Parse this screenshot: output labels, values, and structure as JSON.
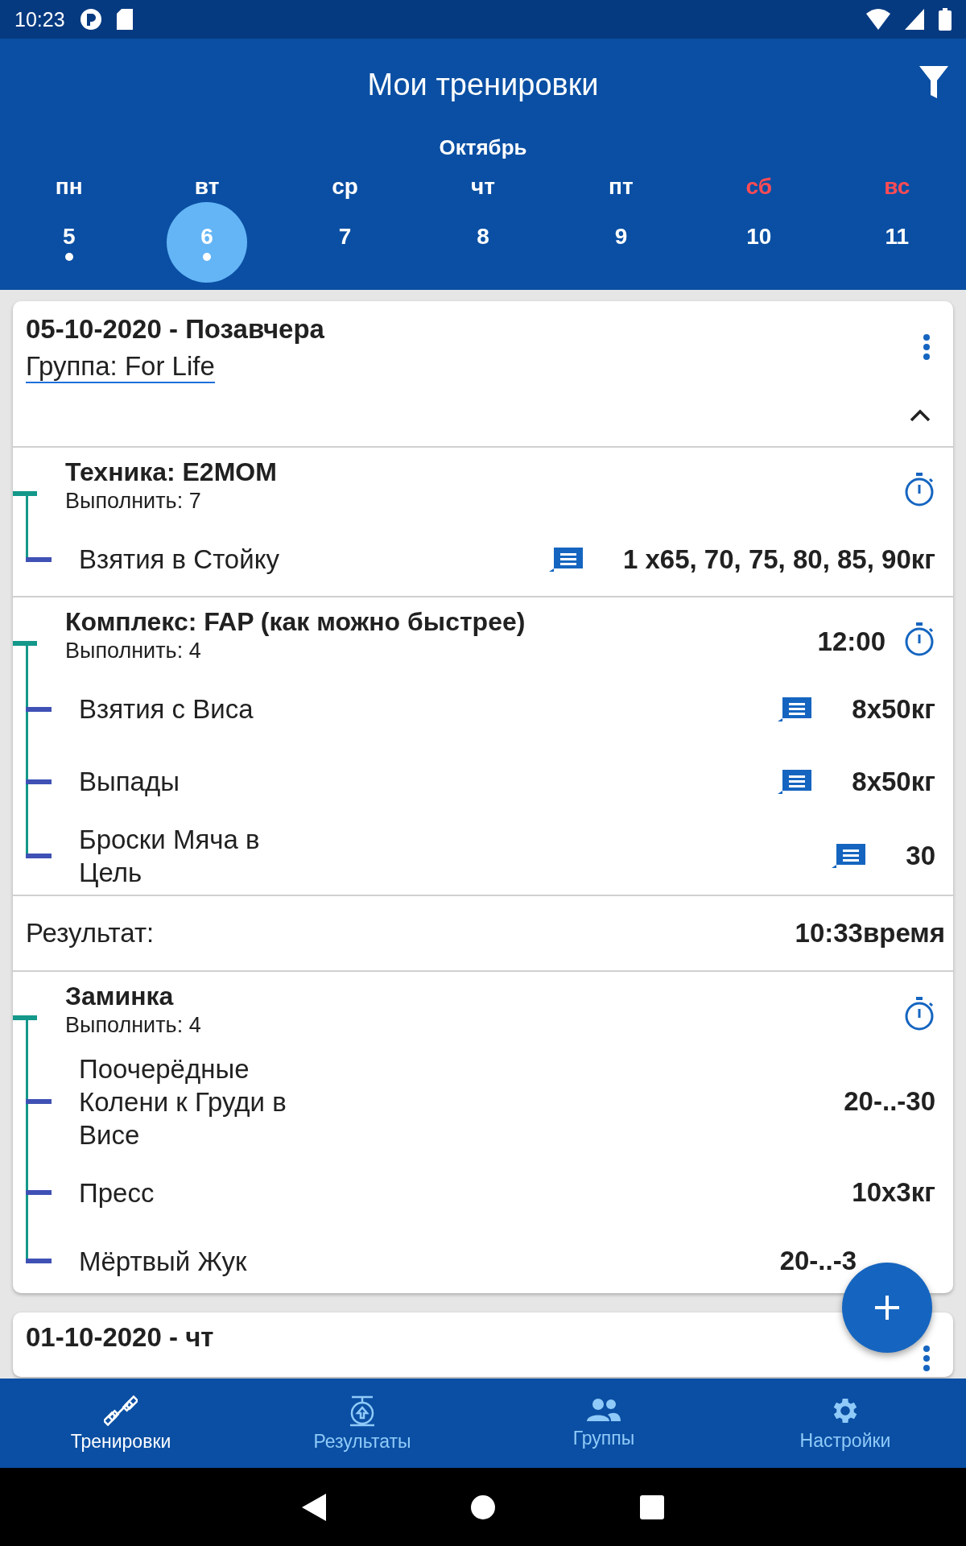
{
  "status_bar": {
    "time": "10:23"
  },
  "app_bar": {
    "title": "Мои тренировки"
  },
  "calendar": {
    "month": "Октябрь",
    "days": [
      {
        "weekday": "пн",
        "date": "5",
        "weekend": false,
        "selected": false,
        "marked": true
      },
      {
        "weekday": "вт",
        "date": "6",
        "weekend": false,
        "selected": true,
        "marked": true
      },
      {
        "weekday": "ср",
        "date": "7",
        "weekend": false,
        "selected": false,
        "marked": false
      },
      {
        "weekday": "чт",
        "date": "8",
        "weekend": false,
        "selected": false,
        "marked": false
      },
      {
        "weekday": "пт",
        "date": "9",
        "weekend": false,
        "selected": false,
        "marked": false
      },
      {
        "weekday": "сб",
        "date": "10",
        "weekend": true,
        "selected": false,
        "marked": false
      },
      {
        "weekday": "вс",
        "date": "11",
        "weekend": true,
        "selected": false,
        "marked": false
      }
    ]
  },
  "workouts": [
    {
      "title": "05-10-2020 - Позавчера",
      "group_link": "Группа: For Life",
      "expanded": true,
      "blocks": [
        {
          "kind": "section",
          "title": "Техника: E2MOM",
          "subtitle": "Выполнить: 7",
          "exercises": [
            {
              "name": "Взятия в Стойку",
              "value": "1 x65, 70, 75, 80, 85, 90кг",
              "has_note": true
            }
          ]
        },
        {
          "kind": "section",
          "title": "Комплекс: FAP (как можно быстрее)",
          "subtitle": "Выполнить: 4",
          "time": "12:00",
          "exercises": [
            {
              "name": "Взятия с Виса",
              "value": "8x50кг",
              "has_note": true
            },
            {
              "name": "Выпады",
              "value": "8x50кг",
              "has_note": true
            },
            {
              "name": "Броски Мяча в Цель",
              "value": "30",
              "has_note": true
            }
          ]
        },
        {
          "kind": "result",
          "label": "Результат:",
          "value": "10:33время"
        },
        {
          "kind": "section",
          "title": "Заминка",
          "subtitle": "Выполнить: 4",
          "exercises": [
            {
              "name": "Поочерёдные Колени к Груди в Висе",
              "value": "20-..-30",
              "has_note": false
            },
            {
              "name": "Пресс",
              "value": "10x3кг",
              "has_note": false
            },
            {
              "name": "Мёртвый Жук",
              "value": "20-..-3",
              "has_note": false
            }
          ]
        }
      ]
    },
    {
      "title": "01-10-2020 - чт"
    }
  ],
  "bottom_nav": [
    {
      "label": "Тренировки",
      "selected": true
    },
    {
      "label": "Результаты",
      "selected": false
    },
    {
      "label": "Группы",
      "selected": false
    },
    {
      "label": "Настройки",
      "selected": false
    }
  ]
}
